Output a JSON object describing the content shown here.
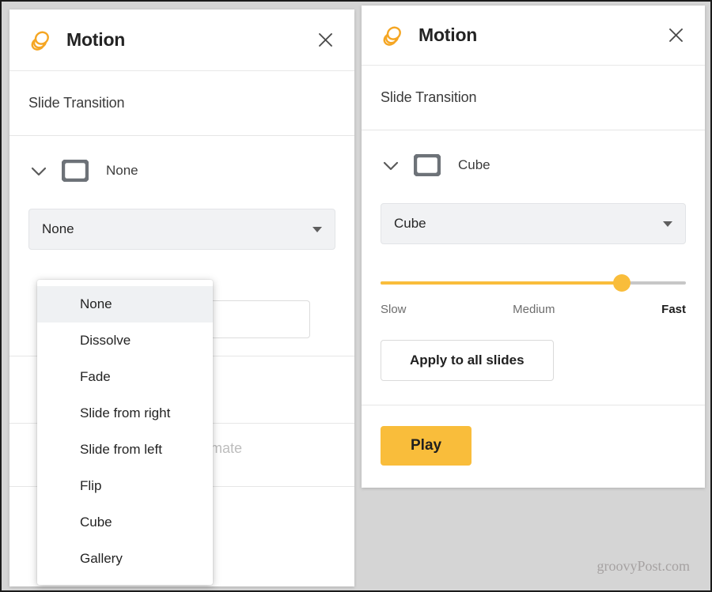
{
  "colors": {
    "brand_orange": "#F9BD3B",
    "page_background": "#D5D5D5",
    "panel_background": "#FFFFFF",
    "select_background": "#F1F2F4",
    "dropdown_highlight": "#EFF1F3",
    "slider_track": "#C7C7C7",
    "text_primary": "#232323",
    "text_muted": "#6D6D6D",
    "placeholder_text": "#BDBDBD"
  },
  "left_panel": {
    "header": {
      "logo_icon": "motion-stacked-slides-icon",
      "title": "Motion",
      "close_icon": "close-icon"
    },
    "section": {
      "label": "Slide Transition"
    },
    "transition_row": {
      "chevron_icon": "chevron-down-icon",
      "slide_icon": "slide-frame-icon",
      "name": "None"
    },
    "select": {
      "value": "None",
      "caret_icon": "caret-down-icon"
    },
    "dropdown": {
      "open": true,
      "selected": "None",
      "options": [
        "None",
        "Dissolve",
        "Fade",
        "Slide from right",
        "Slide from left",
        "Flip",
        "Cube",
        "Gallery"
      ]
    },
    "obscured": {
      "placeholder_fragment": "animate"
    }
  },
  "right_panel": {
    "header": {
      "logo_icon": "motion-stacked-slides-icon",
      "title": "Motion",
      "close_icon": "close-icon"
    },
    "section": {
      "label": "Slide Transition"
    },
    "transition_row": {
      "chevron_icon": "chevron-down-icon",
      "slide_icon": "slide-frame-icon",
      "name": "Cube"
    },
    "select": {
      "value": "Cube",
      "caret_icon": "caret-down-icon"
    },
    "speed_slider": {
      "value_percent": 79,
      "labels": {
        "min": "Slow",
        "mid": "Medium",
        "max": "Fast"
      },
      "active_label": "Fast"
    },
    "apply_button": {
      "label": "Apply to all slides"
    },
    "play_button": {
      "label": "Play"
    }
  },
  "watermark": {
    "text": "groovyPost.com"
  }
}
